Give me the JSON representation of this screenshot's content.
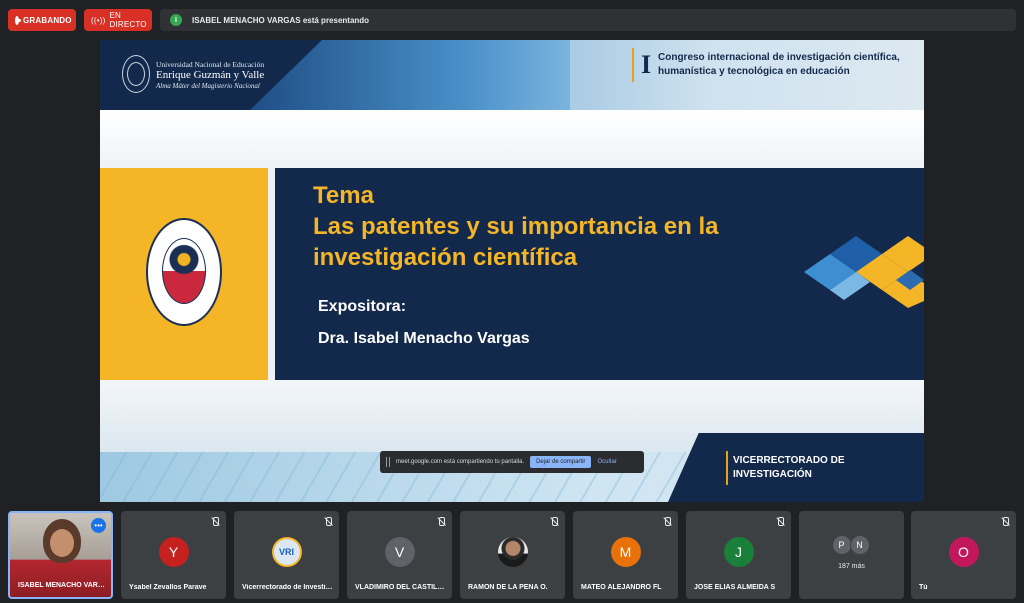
{
  "topbar": {
    "recording_label": "GRABANDO",
    "live_label": "EN DIRECTO",
    "presenting_text": "ISABEL MENACHO VARGAS está presentando",
    "presenting_icon": "I"
  },
  "slide": {
    "university_line1": "Universidad Nacional de Educación",
    "university_line2": "Enrique Guzmán y Valle",
    "university_line3": "Alma Máter del Magisterio Nacional",
    "congress_numeral": "I",
    "congress_title": "Congreso internacional de investigación científica, humanística y tecnológica en educación",
    "tema_line1": "Tema",
    "tema_line2": "Las patentes y su importancia en la investigación científica",
    "expositora_label": "Expositora:",
    "expositora_name": "Dra. Isabel Menacho Vargas",
    "vice_text": "VICERRECTORADO DE INVESTIGACIÓN"
  },
  "share_bar": {
    "message": "meet.google.com está compartiendo tu pantalla.",
    "stop_label": "Dejar de compartir",
    "hide_label": "Ocultar"
  },
  "participants": [
    {
      "name": "ISABEL MENACHO VARGAS"
    },
    {
      "name": "Ysabel Zevallos Parave",
      "initial": "Y",
      "color": "#c5221f"
    },
    {
      "name": "Vicerrectorado de Investigación",
      "initial": "VRI",
      "color": "#1a5fb4"
    },
    {
      "name": "VLADIMIRO DEL CASTILLO",
      "initial": "V",
      "color": "#5f6368"
    },
    {
      "name": "RAMON DE LA PEÑA O.",
      "initial": "",
      "color": "#dadce0"
    },
    {
      "name": "MATEO ALEJANDRO FL",
      "initial": "M",
      "color": "#e8710a"
    },
    {
      "name": "JOSE ELIAS ALMEIDA S",
      "initial": "J",
      "color": "#188038"
    },
    {
      "name": "",
      "group": [
        "P",
        "N"
      ],
      "count": "187 más"
    },
    {
      "name": "Tú",
      "initial": "O",
      "color": "#c2185b"
    }
  ],
  "colors": {
    "accent_gold": "#f4b526",
    "navy": "#13294b",
    "record_red": "#d93025"
  }
}
